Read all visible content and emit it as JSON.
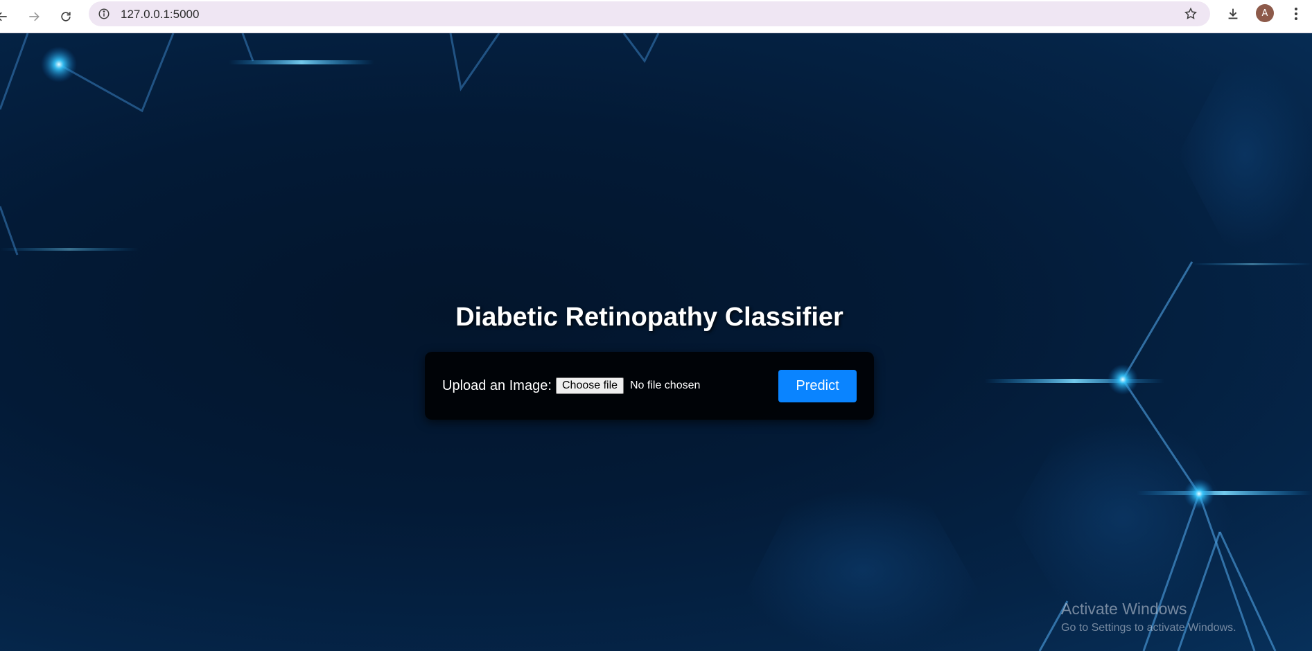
{
  "browser": {
    "url": "127.0.0.1:5000",
    "profile_initial": "A",
    "icons": {
      "back": "back-arrow-icon",
      "forward": "forward-arrow-icon",
      "reload": "reload-icon",
      "site_info": "info-icon",
      "bookmark": "star-icon",
      "downloads": "download-icon",
      "menu": "kebab-menu-icon"
    }
  },
  "page": {
    "title": "Diabetic Retinopathy Classifier",
    "upload_label": "Upload an Image:",
    "file_button_label": "Choose file",
    "file_status": "No file chosen",
    "predict_label": "Predict"
  },
  "watermark": {
    "title": "Activate Windows",
    "subtitle": "Go to Settings to activate Windows."
  },
  "colors": {
    "accent": "#0a84ff",
    "background_dark": "#031a36",
    "card": "#000000",
    "glow": "#2ec8ff"
  }
}
